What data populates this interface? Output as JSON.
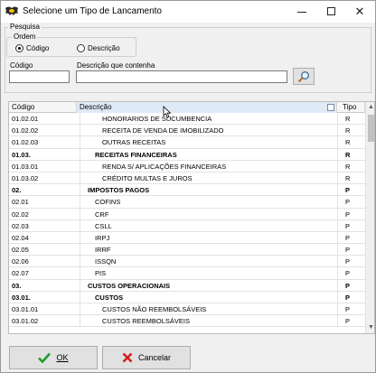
{
  "window": {
    "title": "Selecione um Tipo de Lancamento",
    "app_icon": "bat-icon"
  },
  "search": {
    "group_label": "Pesquisa",
    "order_label": "Ordem",
    "order_options": [
      {
        "label": "Código",
        "checked": true
      },
      {
        "label": "Descrição",
        "checked": false
      }
    ],
    "code_label": "Código",
    "code_value": "",
    "desc_label": "Descrição que contenha",
    "desc_value": ""
  },
  "grid": {
    "columns": [
      "Código",
      "Descrição",
      "Tipo"
    ],
    "rows": [
      {
        "code": "01.02.01",
        "desc": "HONORARIOS DE SUCUMBENCIA",
        "tipo": "R",
        "bold": false,
        "indent": 3
      },
      {
        "code": "01.02.02",
        "desc": "RECEITA DE VENDA DE IMOBILIZADO",
        "tipo": "R",
        "bold": false,
        "indent": 3
      },
      {
        "code": "01.02.03",
        "desc": "OUTRAS RECEITAS",
        "tipo": "R",
        "bold": false,
        "indent": 3
      },
      {
        "code": "01.03.",
        "desc": "RECEITAS FINANCEIRAS",
        "tipo": "R",
        "bold": true,
        "indent": 2
      },
      {
        "code": "01.03.01",
        "desc": "RENDA S/ APLICAÇÕES FINANCEIRAS",
        "tipo": "R",
        "bold": false,
        "indent": 3
      },
      {
        "code": "01.03.02",
        "desc": "CRÉDITO MULTAS E JUROS",
        "tipo": "R",
        "bold": false,
        "indent": 3
      },
      {
        "code": "02.",
        "desc": "IMPOSTOS PAGOS",
        "tipo": "P",
        "bold": true,
        "indent": 1
      },
      {
        "code": "02.01",
        "desc": "COFINS",
        "tipo": "P",
        "bold": false,
        "indent": 2
      },
      {
        "code": "02.02",
        "desc": "CRF",
        "tipo": "P",
        "bold": false,
        "indent": 2
      },
      {
        "code": "02.03",
        "desc": "CSLL",
        "tipo": "P",
        "bold": false,
        "indent": 2
      },
      {
        "code": "02.04",
        "desc": "IRPJ",
        "tipo": "P",
        "bold": false,
        "indent": 2
      },
      {
        "code": "02.05",
        "desc": "IRRF",
        "tipo": "P",
        "bold": false,
        "indent": 2
      },
      {
        "code": "02.06",
        "desc": "ISSQN",
        "tipo": "P",
        "bold": false,
        "indent": 2
      },
      {
        "code": "02.07",
        "desc": "PIS",
        "tipo": "P",
        "bold": false,
        "indent": 2
      },
      {
        "code": "03.",
        "desc": "CUSTOS OPERACIONAIS",
        "tipo": "P",
        "bold": true,
        "indent": 1
      },
      {
        "code": "03.01.",
        "desc": "CUSTOS",
        "tipo": "P",
        "bold": true,
        "indent": 2
      },
      {
        "code": "03.01.01",
        "desc": "CUSTOS NÃO REEMBOLSÁVEIS",
        "tipo": "P",
        "bold": false,
        "indent": 3
      },
      {
        "code": "03.01.02",
        "desc": "CUSTOS REEMBOLSÁVEIS",
        "tipo": "P",
        "bold": false,
        "indent": 3
      }
    ]
  },
  "buttons": {
    "ok_label": "OK",
    "ok_icon": "checkmark-icon",
    "cancel_label": "Cancelar",
    "cancel_icon": "red-x-icon"
  },
  "colors": {
    "ok_green": "#1f9a2e",
    "cancel_red": "#d02020",
    "header_highlight": "#dfeaf8"
  }
}
